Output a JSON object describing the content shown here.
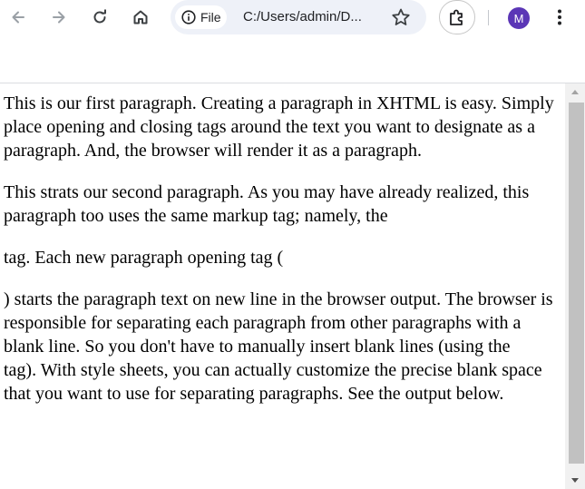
{
  "toolbar": {
    "site_chip_label": "File",
    "url": "C:/Users/admin/D...",
    "avatar_initial": "M"
  },
  "page": {
    "paragraphs": [
      "This is our first paragraph. Creating a paragraph in XHTML is easy. Simply place opening and closing tags around the text you want to designate as a paragraph. And, the browser will render it as a paragraph.",
      "This strats our second paragraph. As you may have already realized, this paragraph too uses the same markup tag; namely, the",
      "tag. Each new paragraph opening tag (",
      ") starts the paragraph text on new line in the browser output. The browser is responsible for separating each paragraph from other paragraphs with a blank line. So you don't have to manually insert blank lines (using the",
      "tag). With style sheets, you can actually customize the precise blank space that you want to use for separating paragraphs. See the output below."
    ]
  },
  "colors": {
    "omnibox_bg": "#eef1f8",
    "avatar_bg": "#5b36b6",
    "scroll_thumb": "#c1c1c1"
  }
}
